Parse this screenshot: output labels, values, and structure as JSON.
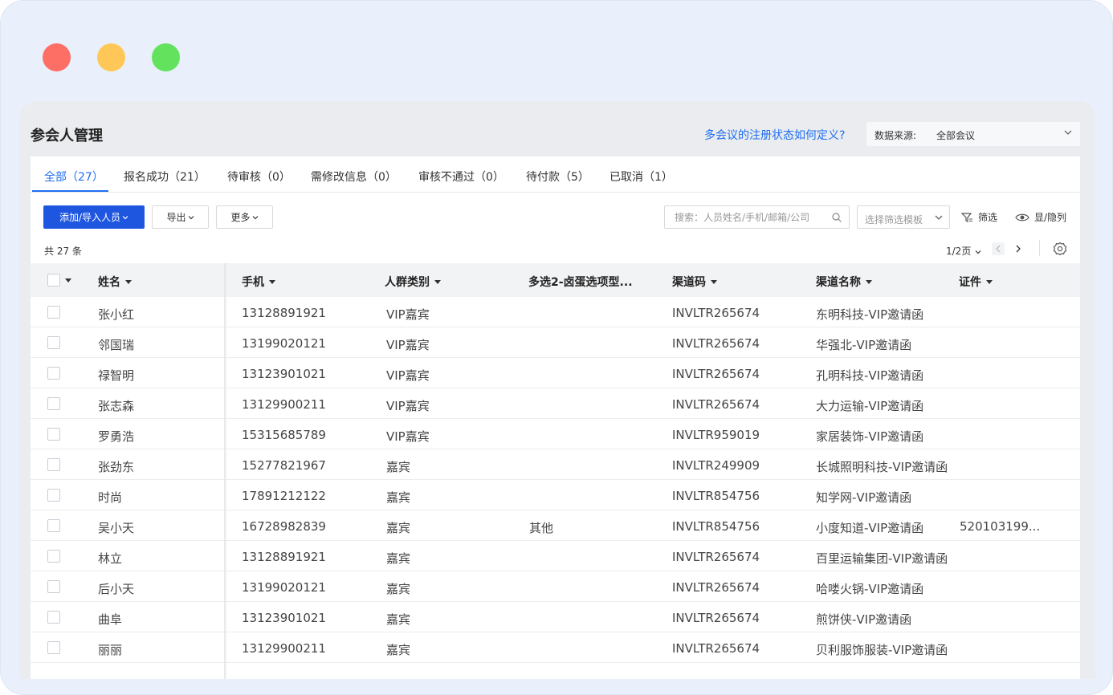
{
  "page_title": "参会人管理",
  "help_link": "多会议的注册状态如何定义?",
  "data_source": {
    "label": "数据来源:",
    "value": "全部会议"
  },
  "tabs": [
    {
      "label": "全部（27）",
      "active": true
    },
    {
      "label": "报名成功（21）",
      "active": false
    },
    {
      "label": "待审核（0）",
      "active": false
    },
    {
      "label": "需修改信息（0）",
      "active": false
    },
    {
      "label": "审核不通过（0）",
      "active": false
    },
    {
      "label": "待付款（5）",
      "active": false
    },
    {
      "label": "已取消（1）",
      "active": false
    }
  ],
  "toolbar": {
    "add_label": "添加/导入人员",
    "export_label": "导出",
    "more_label": "更多",
    "search_placeholder": "搜索：人员姓名/手机/邮箱/公司",
    "filter_template_placeholder": "选择筛选模板",
    "filter_label": "筛选",
    "columns_label": "显/隐列"
  },
  "summary": {
    "total": "共 27 条",
    "page": "1/2页"
  },
  "columns": [
    "姓名",
    "手机",
    "人群类别",
    "多选2-卤蛋选项型...",
    "渠道码",
    "渠道名称",
    "证件"
  ],
  "rows": [
    {
      "name": "张小红",
      "phone": "13128891921",
      "group": "VIP嘉宾",
      "multi": "",
      "code": "INVLTR265674",
      "channel": "东明科技-VIP邀请函",
      "cert": ""
    },
    {
      "name": "邻国瑞",
      "phone": "13199020121",
      "group": "VIP嘉宾",
      "multi": "",
      "code": "INVLTR265674",
      "channel": "华强北-VIP邀请函",
      "cert": ""
    },
    {
      "name": "禄智明",
      "phone": "13123901021",
      "group": "VIP嘉宾",
      "multi": "",
      "code": "INVLTR265674",
      "channel": "孔明科技-VIP邀请函",
      "cert": ""
    },
    {
      "name": "张志森",
      "phone": "13129900211",
      "group": "VIP嘉宾",
      "multi": "",
      "code": "INVLTR265674",
      "channel": "大力运输-VIP邀请函",
      "cert": ""
    },
    {
      "name": "罗勇浩",
      "phone": "15315685789",
      "group": "VIP嘉宾",
      "multi": "",
      "code": "INVLTR959019",
      "channel": "家居装饰-VIP邀请函",
      "cert": ""
    },
    {
      "name": "张劲东",
      "phone": "15277821967",
      "group": "嘉宾",
      "multi": "",
      "code": "INVLTR249909",
      "channel": "长城照明科技-VIP邀请函",
      "cert": ""
    },
    {
      "name": "时尚",
      "phone": "17891212122",
      "group": "嘉宾",
      "multi": "",
      "code": "INVLTR854756",
      "channel": "知学网-VIP邀请函",
      "cert": ""
    },
    {
      "name": "吴小天",
      "phone": "16728982839",
      "group": "嘉宾",
      "multi": "其他",
      "code": "INVLTR854756",
      "channel": "小度知道-VIP邀请函",
      "cert": "520103199..."
    },
    {
      "name": "林立",
      "phone": "13128891921",
      "group": "嘉宾",
      "multi": "",
      "code": "INVLTR265674",
      "channel": "百里运输集团-VIP邀请函",
      "cert": ""
    },
    {
      "name": "后小天",
      "phone": "13199020121",
      "group": "嘉宾",
      "multi": "",
      "code": "INVLTR265674",
      "channel": "哈喽火锅-VIP邀请函",
      "cert": ""
    },
    {
      "name": "曲阜",
      "phone": "13123901021",
      "group": "嘉宾",
      "multi": "",
      "code": "INVLTR265674",
      "channel": "煎饼侠-VIP邀请函",
      "cert": ""
    },
    {
      "name": "丽丽",
      "phone": "13129900211",
      "group": "嘉宾",
      "multi": "",
      "code": "INVLTR265674",
      "channel": "贝利服饰服装-VIP邀请函",
      "cert": ""
    }
  ],
  "colors": {
    "primary": "#1e56e0",
    "link": "#1e6ef2",
    "frame": "#e9f0fb"
  }
}
